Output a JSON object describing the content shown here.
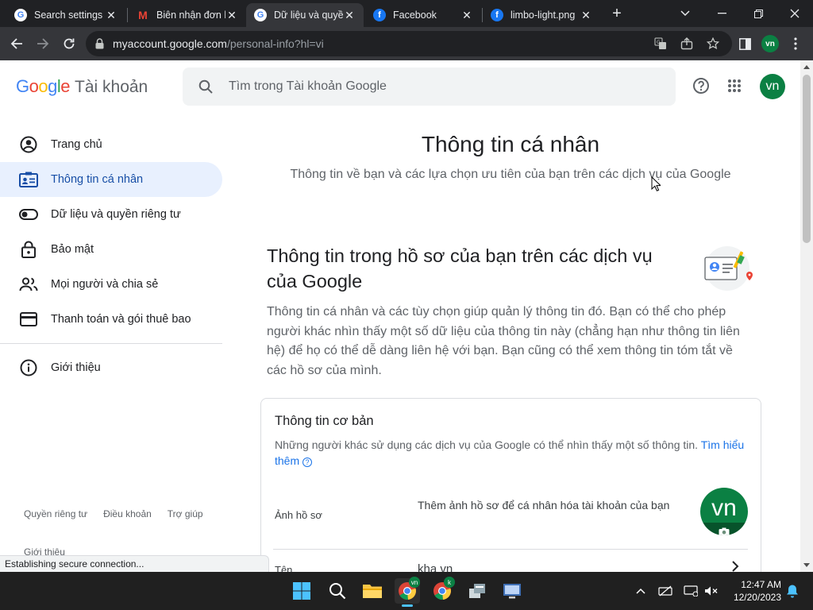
{
  "browser": {
    "tabs": [
      {
        "title": "Search settings",
        "favicon": "google-g",
        "active": false
      },
      {
        "title": "Biên nhận đơn h",
        "favicon": "gmail-m",
        "active": false
      },
      {
        "title": "Dữ liệu và quyền",
        "favicon": "google-g",
        "active": true
      },
      {
        "title": "Facebook",
        "favicon": "facebook-f",
        "active": false
      },
      {
        "title": "limbo-light.png",
        "favicon": "facebook-f",
        "active": false
      }
    ],
    "url_host": "myaccount.google.com",
    "url_path": "/personal-info?hl=vi",
    "profile_initials": "vn",
    "status_text": "Establishing secure connection..."
  },
  "header": {
    "logo_text": "Google",
    "product": "Tài khoản",
    "search_placeholder": "Tìm trong Tài khoản Google",
    "avatar_initials": "vn"
  },
  "nav": {
    "items": [
      {
        "label": "Trang chủ",
        "icon": "account-circle-icon"
      },
      {
        "label": "Thông tin cá nhân",
        "icon": "id-card-icon",
        "active": true
      },
      {
        "label": "Dữ liệu và quyền riêng tư",
        "icon": "toggle-icon"
      },
      {
        "label": "Bảo mật",
        "icon": "lock-icon"
      },
      {
        "label": "Mọi người và chia sẻ",
        "icon": "people-icon"
      },
      {
        "label": "Thanh toán và gói thuê bao",
        "icon": "credit-card-icon"
      }
    ],
    "about": "Giới thiệu",
    "footer": {
      "privacy": "Quyền riêng tư",
      "terms": "Điều khoản",
      "help": "Trợ giúp",
      "about": "Giới thiệu"
    }
  },
  "main": {
    "title": "Thông tin cá nhân",
    "subtitle": "Thông tin về bạn và các lựa chọn ưu tiên của bạn trên các dịch vụ của Google",
    "section_title": "Thông tin trong hồ sơ của bạn trên các dịch vụ của Google",
    "section_desc": "Thông tin cá nhân và các tùy chọn giúp quản lý thông tin đó. Bạn có thể cho phép người khác nhìn thấy một số dữ liệu của thông tin này (chẳng hạn như thông tin liên hệ) để họ có thể dễ dàng liên hệ với bạn. Bạn cũng có thể xem thông tin tóm tắt về các hồ sơ của mình.",
    "card": {
      "title": "Thông tin cơ bản",
      "desc": "Những người khác sử dụng các dịch vụ của Google có thể nhìn thấy một số thông tin.",
      "learn_more": "Tìm hiểu thêm",
      "photo_label": "Ảnh hồ sơ",
      "photo_value": "Thêm ảnh hồ sơ để cá nhân hóa tài khoản của bạn",
      "photo_initials": "vn",
      "name_label": "Tên",
      "name_value": "kha vn"
    }
  },
  "taskbar": {
    "time": "12:47 AM",
    "date": "12/20/2023",
    "chrome_badge_1": "vn",
    "chrome_badge_2": "k"
  },
  "colors": {
    "accent": "#1a73e8",
    "nav_active_bg": "#e8f0fe",
    "avatar_green": "#0b8043",
    "chrome_dark": "#202124",
    "chrome_toolbar": "#35363a"
  }
}
